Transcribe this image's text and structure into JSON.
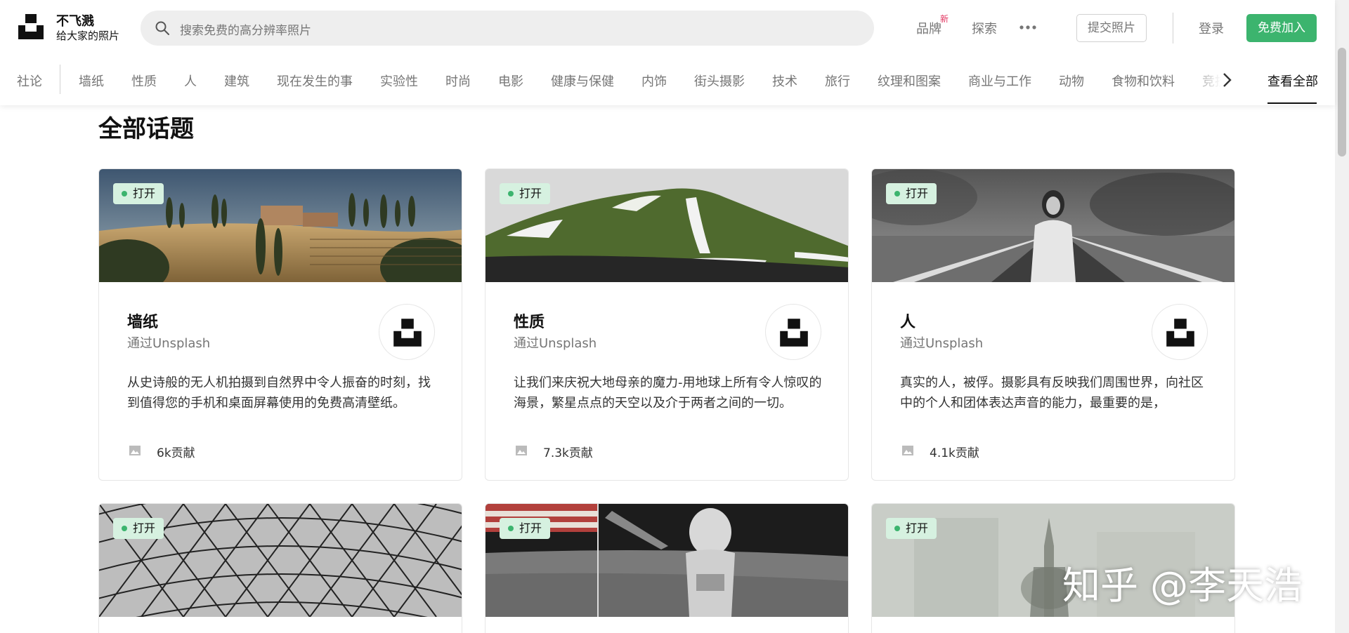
{
  "brand": {
    "name": "不飞溅",
    "tagline": "给大家的照片"
  },
  "search": {
    "placeholder": "搜索免费的高分辨率照片"
  },
  "nav": {
    "brands": "品牌",
    "brands_badge": "新",
    "explore": "探索",
    "submit": "提交照片",
    "login": "登录",
    "join": "免费加入"
  },
  "tabs": {
    "pinned": "社论",
    "items": [
      "墙纸",
      "性质",
      "人",
      "建筑",
      "现在发生的事",
      "实验性",
      "时尚",
      "电影",
      "健康与保健",
      "内饰",
      "街头摄影",
      "技术",
      "旅行",
      "纹理和图案",
      "商业与工作",
      "动物",
      "食物和饮料",
      "竞技"
    ],
    "view_all": "查看全部"
  },
  "page_title": "全部话题",
  "cards": [
    {
      "badge": "打开",
      "title": "墙纸",
      "author": "通过Unsplash",
      "description": "从史诗般的无人机拍摄到自然界中令人振奋的时刻，找到值得您的手机和桌面屏幕使用的免费高清壁纸。",
      "count": "6k贡献"
    },
    {
      "badge": "打开",
      "title": "性质",
      "author": "通过Unsplash",
      "description": "让我们来庆祝大地母亲的魔力-用地球上所有令人惊叹的海景，繁星点点的天空以及介于两者之间的一切。",
      "count": "7.3k贡献"
    },
    {
      "badge": "打开",
      "title": "人",
      "author": "通过Unsplash",
      "description": "真实的人，被俘。摄影具有反映我们周围世界，向社区中的个人和团体表达声音的能力，最重要的是，",
      "count": "4.1k贡献"
    },
    {
      "badge": "打开"
    },
    {
      "badge": "打开"
    },
    {
      "badge": "打开"
    }
  ],
  "watermark": "知乎 @李天浩",
  "colors": {
    "accent": "#3cb46e",
    "badge_bg": "#d6f1e0",
    "text_muted": "#767676",
    "new_badge": "#e2345f"
  },
  "icons": [
    "unsplash-logo-icon",
    "search-icon",
    "more-dots-icon",
    "chevron-right-icon",
    "photo-icon"
  ]
}
